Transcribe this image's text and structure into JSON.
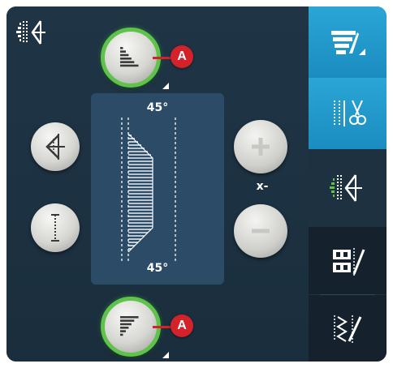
{
  "preview": {
    "top_angle": "45°",
    "bottom_angle": "45°"
  },
  "buttons": {
    "top_callout": "A",
    "bottom_callout": "A"
  },
  "stepper": {
    "label": "x-"
  },
  "colors": {
    "panel_bg": "#1d3140",
    "preview_bg": "#2b4b66",
    "active_ring": "#5fc24a",
    "callout": "#d3222a",
    "tab_blue": "#1b8cc0"
  },
  "icons": {
    "top_left": "mirror-stitch-icon",
    "top_button": "ascending-staircase-icon",
    "bottom_button": "descending-staircase-icon",
    "left_upper": "mirror-end-icon",
    "left_lower": "stitch-length-icon",
    "tab_1": "pattern-sequence-icon",
    "tab_2": "stitch-cut-icon",
    "tab_3": "mirror-stitch-icon",
    "tab_4": "lettering-edit-icon",
    "tab_5": "zigzag-edit-icon"
  }
}
